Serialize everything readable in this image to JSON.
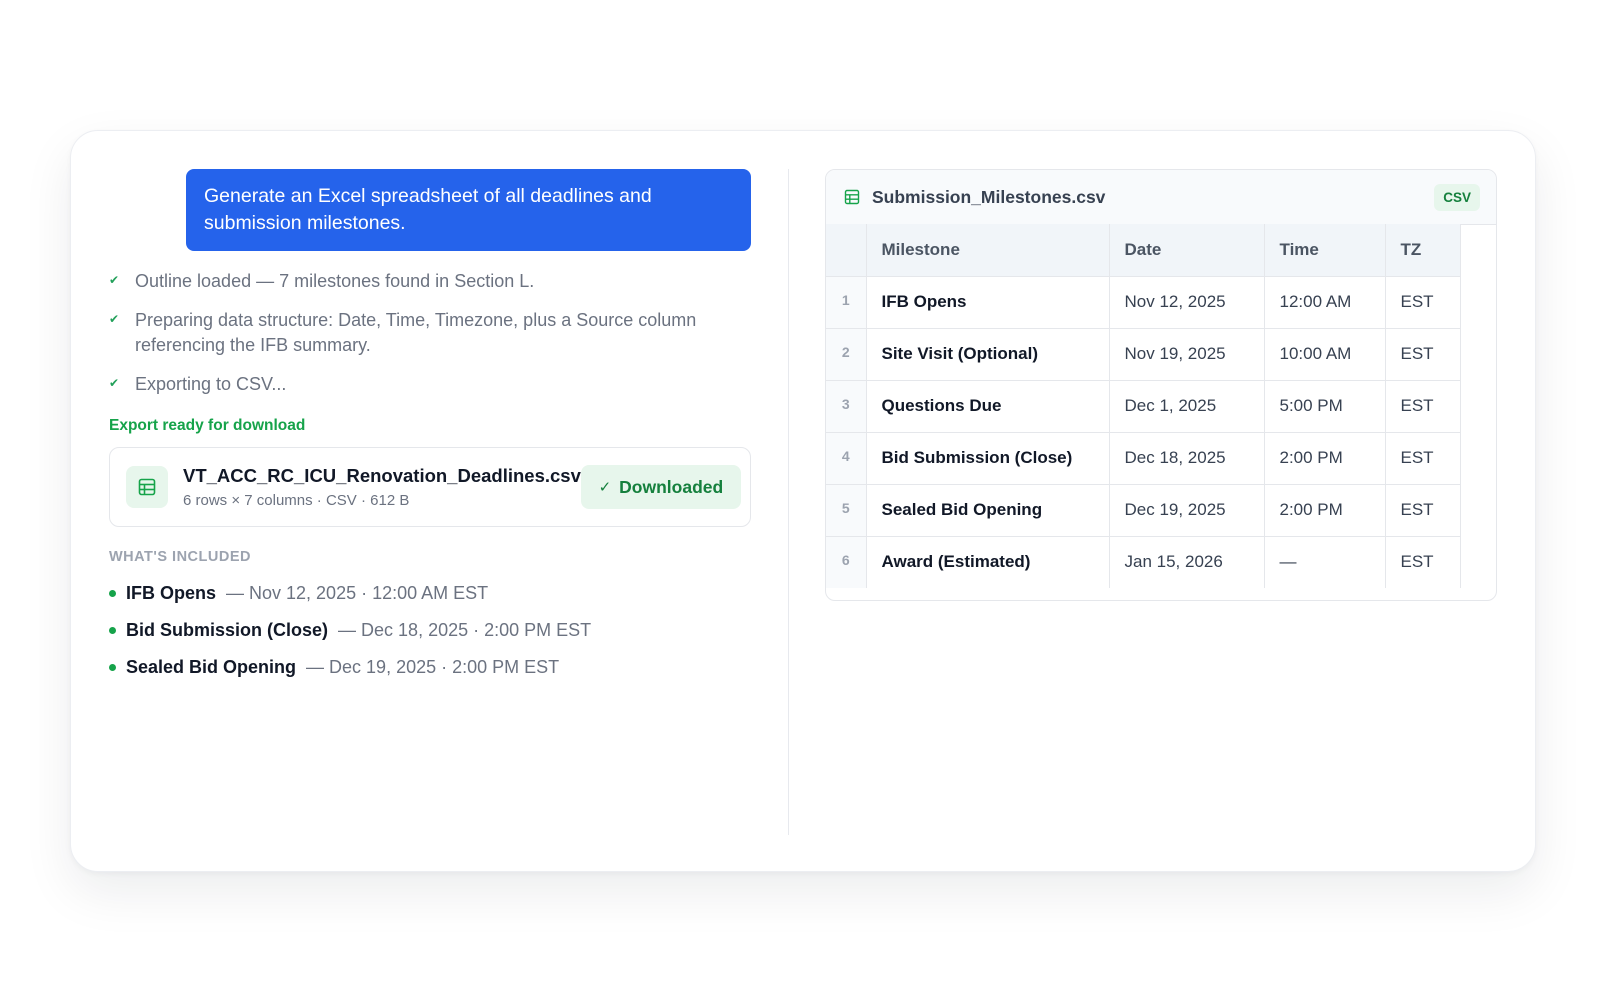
{
  "chat": {
    "prompt": "Generate an Excel spreadsheet of all deadlines and submission milestones.",
    "steps": [
      {
        "text": "Outline loaded — 7 milestones found in Section L.",
        "icon": "check-icon"
      },
      {
        "text": "Preparing data structure: Date, Time, Timezone, plus a Source column referencing the IFB summary.",
        "icon": "check-icon"
      },
      {
        "text": "Exporting to CSV...",
        "icon": "check-icon"
      }
    ],
    "ready_label": "Export ready for download",
    "file": {
      "name": "VT_ACC_RC_ICU_Renovation_Deadlines.csv",
      "meta": "6 rows × 7 columns · CSV · 612 B",
      "icon": "spreadsheet-icon",
      "button_label": "Downloaded"
    },
    "included_heading": "WHAT'S INCLUDED",
    "included": [
      {
        "name": "IFB Opens",
        "detail": "— Nov 12, 2025 · 12:00 AM EST"
      },
      {
        "name": "Bid Submission (Close)",
        "detail": "— Dec 18, 2025 · 2:00 PM EST"
      },
      {
        "name": "Sealed Bid Opening",
        "detail": "— Dec 19, 2025 · 2:00 PM EST"
      }
    ]
  },
  "preview": {
    "filename": "Submission_Milestones.csv",
    "badge": "CSV",
    "columns": [
      "Milestone",
      "Date",
      "Time",
      "TZ"
    ],
    "rows": [
      {
        "n": "1",
        "milestone": "IFB Opens",
        "date": "Nov 12, 2025",
        "time": "12:00 AM",
        "tz": "EST"
      },
      {
        "n": "2",
        "milestone": "Site Visit (Optional)",
        "date": "Nov 19, 2025",
        "time": "10:00 AM",
        "tz": "EST"
      },
      {
        "n": "3",
        "milestone": "Questions Due",
        "date": "Dec 1, 2025",
        "time": "5:00 PM",
        "tz": "EST"
      },
      {
        "n": "4",
        "milestone": "Bid Submission (Close)",
        "date": "Dec 18, 2025",
        "time": "2:00 PM",
        "tz": "EST"
      },
      {
        "n": "5",
        "milestone": "Sealed Bid Opening",
        "date": "Dec 19, 2025",
        "time": "2:00 PM",
        "tz": "EST"
      },
      {
        "n": "6",
        "milestone": "Award (Estimated)",
        "date": "Jan 15, 2026",
        "time": "—",
        "tz": "EST"
      }
    ]
  },
  "colors": {
    "accent": "#2563eb",
    "success": "#16a34a"
  }
}
